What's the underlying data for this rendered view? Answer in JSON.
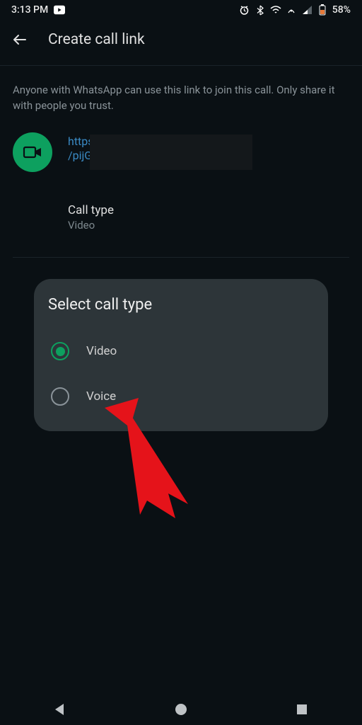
{
  "status": {
    "time": "3:13 PM",
    "battery": "58%"
  },
  "header": {
    "title": "Create call link"
  },
  "main": {
    "description": "Anyone with WhatsApp can use this link to join this call. Only share it with people you trust.",
    "link_line1": "https",
    "link_line2": "/pijG",
    "type_label": "Call type",
    "type_value": "Video"
  },
  "sheet": {
    "title": "Select call type",
    "options": [
      {
        "label": "Video",
        "selected": true
      },
      {
        "label": "Voice",
        "selected": false
      }
    ]
  }
}
